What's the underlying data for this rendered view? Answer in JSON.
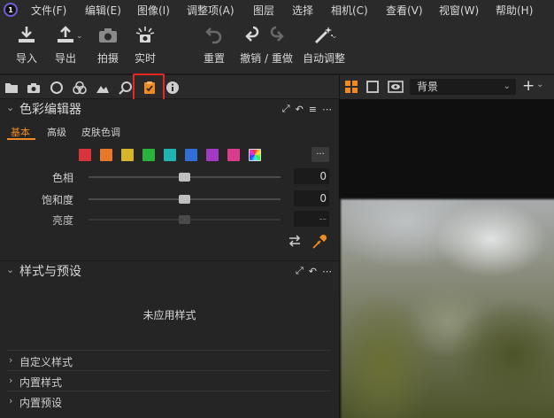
{
  "menu": [
    "文件(F)",
    "编辑(E)",
    "图像(I)",
    "调整项(A)",
    "图层",
    "选择",
    "相机(C)",
    "查看(V)",
    "视窗(W)",
    "帮助(H)"
  ],
  "toolbar": {
    "import": "导入",
    "export": "导出",
    "capture": "拍摄",
    "live": "实时",
    "reset": "重置",
    "undo_redo": "撤销 / 重做",
    "auto_adjust": "自动调整"
  },
  "color_editor": {
    "title": "色彩编辑器",
    "tabs": [
      "基本",
      "高级",
      "皮肤色调"
    ],
    "active_tab": "基本",
    "swatches": [
      "#d9343c",
      "#e8782a",
      "#d8b42a",
      "#2ab33c",
      "#1fb5b0",
      "#2f6fd6",
      "#a23bc4",
      "#d93c8c"
    ],
    "more": "...",
    "sliders": [
      {
        "label": "色相",
        "value": "0",
        "level": 0.5,
        "enabled": true
      },
      {
        "label": "饱和度",
        "value": "0",
        "level": 0.5,
        "enabled": true
      },
      {
        "label": "亮度",
        "value": "--",
        "level": 0.5,
        "enabled": false
      }
    ]
  },
  "styles_panel": {
    "title": "样式与预设",
    "empty": "未应用样式",
    "sections": [
      "自定义样式",
      "内置样式",
      "内置预设"
    ]
  },
  "viewer": {
    "background_select": "背景"
  },
  "colors": {
    "accent": "#f08a24",
    "highlight": "#e52820"
  }
}
